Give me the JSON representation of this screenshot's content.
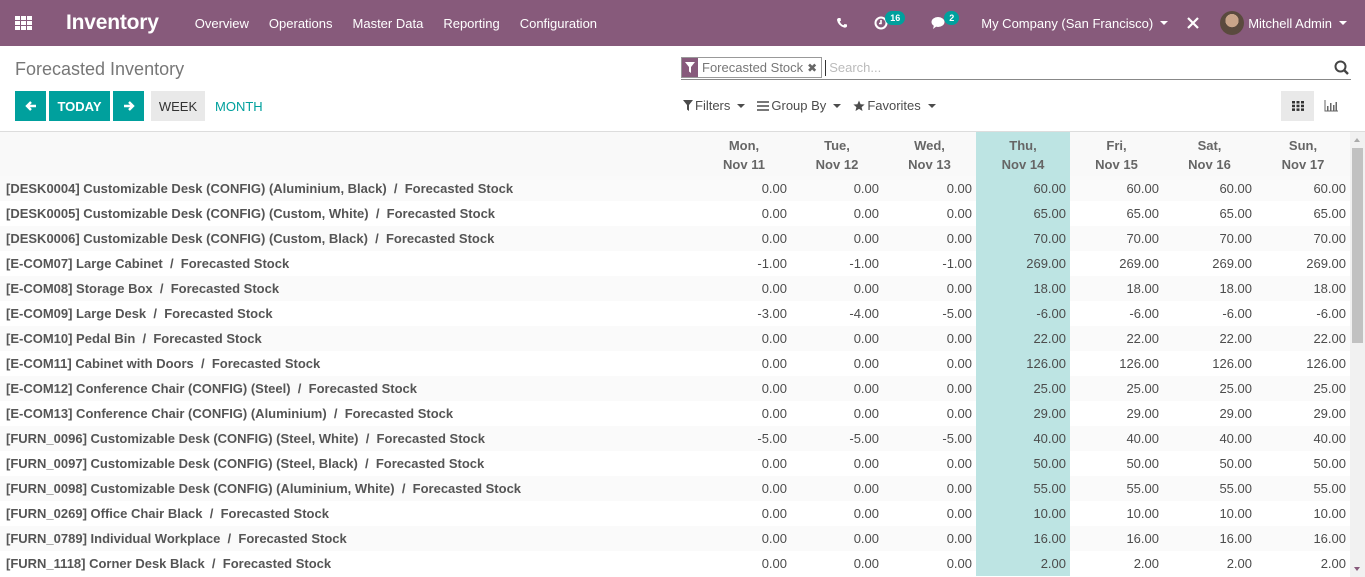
{
  "navbar": {
    "app_title": "Inventory",
    "menu": [
      "Overview",
      "Operations",
      "Master Data",
      "Reporting",
      "Configuration"
    ],
    "activity_count": "16",
    "messages_count": "2",
    "company": "My Company (San Francisco)",
    "user": "Mitchell Admin"
  },
  "control": {
    "title": "Forecasted Inventory",
    "prev_label": "←",
    "today_label": "TODAY",
    "next_label": "→",
    "week_label": "WEEK",
    "month_label": "MONTH",
    "search": {
      "facet_value": "Forecasted Stock",
      "placeholder": "Search..."
    },
    "filters_label": "Filters",
    "groupby_label": "Group By",
    "favorites_label": "Favorites"
  },
  "grid": {
    "columns": [
      {
        "day": "Mon,",
        "date": "Nov 11"
      },
      {
        "day": "Tue,",
        "date": "Nov 12"
      },
      {
        "day": "Wed,",
        "date": "Nov 13"
      },
      {
        "day": "Thu,",
        "date": "Nov 14",
        "today": true
      },
      {
        "day": "Fri,",
        "date": "Nov 15"
      },
      {
        "day": "Sat,",
        "date": "Nov 16"
      },
      {
        "day": "Sun,",
        "date": "Nov 17"
      }
    ],
    "rows": [
      {
        "label": "[DESK0004] Customizable Desk (CONFIG) (Aluminium, Black)  /  Forecasted Stock",
        "values": [
          "0.00",
          "0.00",
          "0.00",
          "60.00",
          "60.00",
          "60.00",
          "60.00"
        ]
      },
      {
        "label": "[DESK0005] Customizable Desk (CONFIG) (Custom, White)  /  Forecasted Stock",
        "values": [
          "0.00",
          "0.00",
          "0.00",
          "65.00",
          "65.00",
          "65.00",
          "65.00"
        ]
      },
      {
        "label": "[DESK0006] Customizable Desk (CONFIG) (Custom, Black)  /  Forecasted Stock",
        "values": [
          "0.00",
          "0.00",
          "0.00",
          "70.00",
          "70.00",
          "70.00",
          "70.00"
        ]
      },
      {
        "label": "[E-COM07] Large Cabinet  /  Forecasted Stock",
        "values": [
          "-1.00",
          "-1.00",
          "-1.00",
          "269.00",
          "269.00",
          "269.00",
          "269.00"
        ]
      },
      {
        "label": "[E-COM08] Storage Box  /  Forecasted Stock",
        "values": [
          "0.00",
          "0.00",
          "0.00",
          "18.00",
          "18.00",
          "18.00",
          "18.00"
        ]
      },
      {
        "label": "[E-COM09] Large Desk  /  Forecasted Stock",
        "values": [
          "-3.00",
          "-4.00",
          "-5.00",
          "-6.00",
          "-6.00",
          "-6.00",
          "-6.00"
        ]
      },
      {
        "label": "[E-COM10] Pedal Bin  /  Forecasted Stock",
        "values": [
          "0.00",
          "0.00",
          "0.00",
          "22.00",
          "22.00",
          "22.00",
          "22.00"
        ]
      },
      {
        "label": "[E-COM11] Cabinet with Doors  /  Forecasted Stock",
        "values": [
          "0.00",
          "0.00",
          "0.00",
          "126.00",
          "126.00",
          "126.00",
          "126.00"
        ]
      },
      {
        "label": "[E-COM12] Conference Chair (CONFIG) (Steel)  /  Forecasted Stock",
        "values": [
          "0.00",
          "0.00",
          "0.00",
          "25.00",
          "25.00",
          "25.00",
          "25.00"
        ]
      },
      {
        "label": "[E-COM13] Conference Chair (CONFIG) (Aluminium)  /  Forecasted Stock",
        "values": [
          "0.00",
          "0.00",
          "0.00",
          "29.00",
          "29.00",
          "29.00",
          "29.00"
        ]
      },
      {
        "label": "[FURN_0096] Customizable Desk (CONFIG) (Steel, White)  /  Forecasted Stock",
        "values": [
          "-5.00",
          "-5.00",
          "-5.00",
          "40.00",
          "40.00",
          "40.00",
          "40.00"
        ]
      },
      {
        "label": "[FURN_0097] Customizable Desk (CONFIG) (Steel, Black)  /  Forecasted Stock",
        "values": [
          "0.00",
          "0.00",
          "0.00",
          "50.00",
          "50.00",
          "50.00",
          "50.00"
        ]
      },
      {
        "label": "[FURN_0098] Customizable Desk (CONFIG) (Aluminium, White)  /  Forecasted Stock",
        "values": [
          "0.00",
          "0.00",
          "0.00",
          "55.00",
          "55.00",
          "55.00",
          "55.00"
        ]
      },
      {
        "label": "[FURN_0269] Office Chair Black  /  Forecasted Stock",
        "values": [
          "0.00",
          "0.00",
          "0.00",
          "10.00",
          "10.00",
          "10.00",
          "10.00"
        ]
      },
      {
        "label": "[FURN_0789] Individual Workplace  /  Forecasted Stock",
        "values": [
          "0.00",
          "0.00",
          "0.00",
          "16.00",
          "16.00",
          "16.00",
          "16.00"
        ]
      },
      {
        "label": "[FURN_1118] Corner Desk Black  /  Forecasted Stock",
        "values": [
          "0.00",
          "0.00",
          "0.00",
          "2.00",
          "2.00",
          "2.00",
          "2.00"
        ]
      }
    ]
  }
}
